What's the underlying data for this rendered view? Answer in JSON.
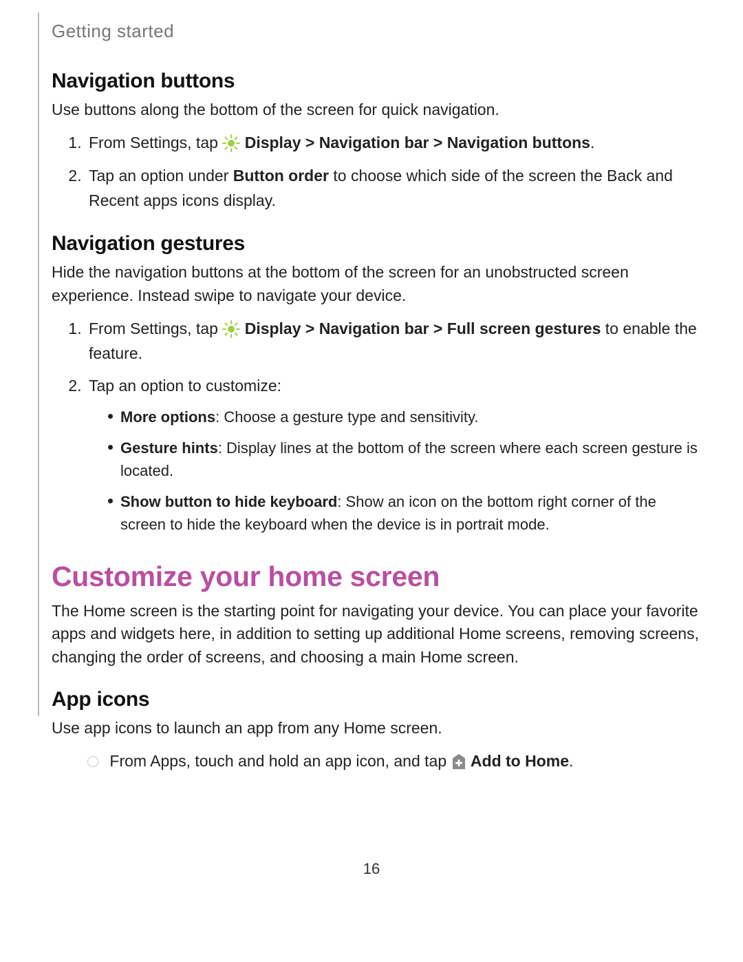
{
  "breadcrumb": "Getting started",
  "section1": {
    "heading": "Navigation buttons",
    "intro": "Use buttons along the bottom of the screen for quick navigation.",
    "steps": {
      "s1_pre": "From Settings, tap ",
      "s1_bold": "Display > Navigation bar > Navigation buttons",
      "s1_post": ".",
      "s2_pre": "Tap an option under ",
      "s2_bold": "Button order",
      "s2_post": " to choose which side of the screen the Back and Recent apps icons display."
    }
  },
  "section2": {
    "heading": "Navigation gestures",
    "intro": "Hide the navigation buttons at the bottom of the screen for an unobstructed screen experience. Instead swipe to navigate your device.",
    "steps": {
      "s1_pre": "From Settings, tap ",
      "s1_bold": "Display > Navigation bar > Full screen gestures",
      "s1_post": " to enable the feature.",
      "s2": "Tap an option to customize:"
    },
    "bullets": {
      "b1_bold": "More options",
      "b1_rest": ": Choose a gesture type and sensitivity.",
      "b2_bold": "Gesture hints",
      "b2_rest": ": Display lines at the bottom of the screen where each screen gesture is located.",
      "b3_bold": "Show button to hide keyboard",
      "b3_rest": ": Show an icon on the bottom right corner of the screen to hide the keyboard when the device is in portrait mode."
    }
  },
  "major": {
    "heading": "Customize your home screen",
    "intro": "The Home screen is the starting point for navigating your device. You can place your favorite apps and widgets here, in addition to setting up additional Home screens, removing screens, changing the order of screens, and choosing a main Home screen."
  },
  "section3": {
    "heading": "App icons",
    "intro": "Use app icons to launch an app from any Home screen.",
    "item_pre": "From Apps, touch and hold an app icon, and tap ",
    "item_bold": "Add to Home",
    "item_post": "."
  },
  "page_number": "16"
}
